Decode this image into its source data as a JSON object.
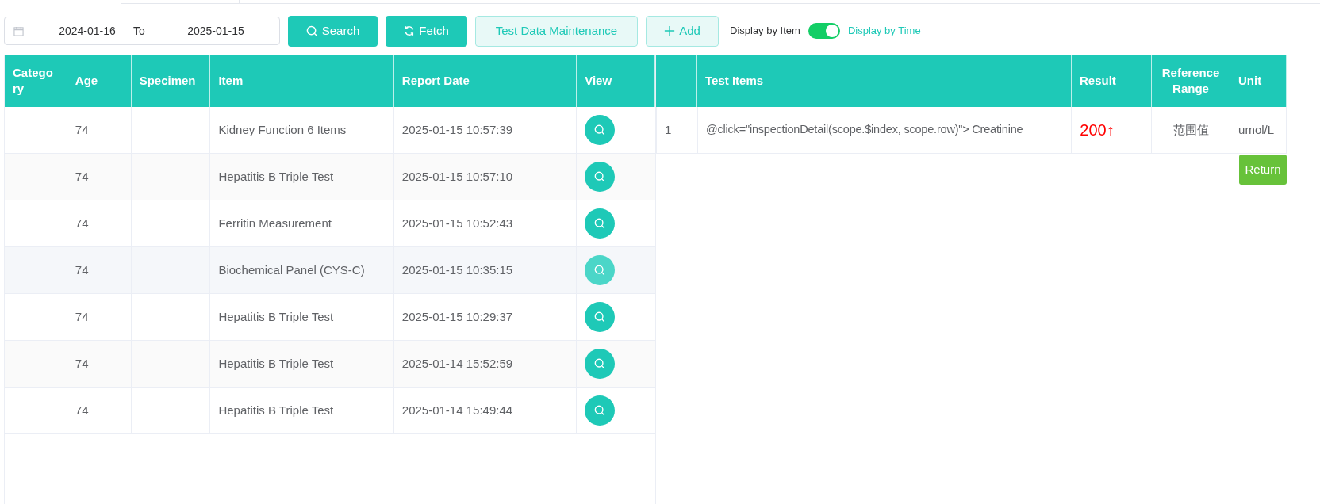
{
  "filters": {
    "start_date": "2024-01-16",
    "separator": "To",
    "end_date": "2025-01-15"
  },
  "buttons": [
    {
      "kind": "solid",
      "label": "Search"
    },
    {
      "kind": "solid",
      "label": "Fetch"
    },
    {
      "kind": "light",
      "label": "Test Data Maintenance"
    },
    {
      "kind": "light",
      "label": "Add"
    }
  ],
  "display_toggle": {
    "off_label": "Display by Item",
    "on_label": "Display by Time",
    "on": true
  },
  "records_table": {
    "columns": [
      "Catego ry",
      "Age",
      "Specimen",
      "Item",
      "Report Date",
      "View"
    ],
    "rows": [
      {
        "category": "",
        "age": "74",
        "specimen": "",
        "item": "Kidney Function 6 Items",
        "report_date": "2025-01-15 10:57:39",
        "hovered": false
      },
      {
        "category": "",
        "age": "74",
        "specimen": "",
        "item": "Hepatitis B Triple Test",
        "report_date": "2025-01-15 10:57:10",
        "hovered": false
      },
      {
        "category": "",
        "age": "74",
        "specimen": "",
        "item": "Ferritin Measurement",
        "report_date": "2025-01-15 10:52:43",
        "hovered": false
      },
      {
        "category": "",
        "age": "74",
        "specimen": "",
        "item": "Biochemical Panel (CYS-C)",
        "report_date": "2025-01-15 10:35:15",
        "hovered": true
      },
      {
        "category": "",
        "age": "74",
        "specimen": "",
        "item": "Hepatitis B Triple Test",
        "report_date": "2025-01-15 10:29:37",
        "hovered": false
      },
      {
        "category": "",
        "age": "74",
        "specimen": "",
        "item": "Hepatitis B Triple Test",
        "report_date": "2025-01-14 15:52:59",
        "hovered": false
      },
      {
        "category": "",
        "age": "74",
        "specimen": "",
        "item": "Hepatitis B Triple Test",
        "report_date": "2025-01-14 15:49:44",
        "hovered": false
      }
    ]
  },
  "detail_table": {
    "columns": [
      "",
      "Test Items",
      "Result",
      "Reference Range",
      "Unit"
    ],
    "rows": [
      {
        "index": "1",
        "test_item": "@click=\"inspectionDetail(scope.$index, scope.row)\"> Creatinine",
        "result": "200↑",
        "abnormal": true,
        "reference_range": "范围值",
        "unit": "umol/L"
      }
    ]
  },
  "return_button": "Return"
}
